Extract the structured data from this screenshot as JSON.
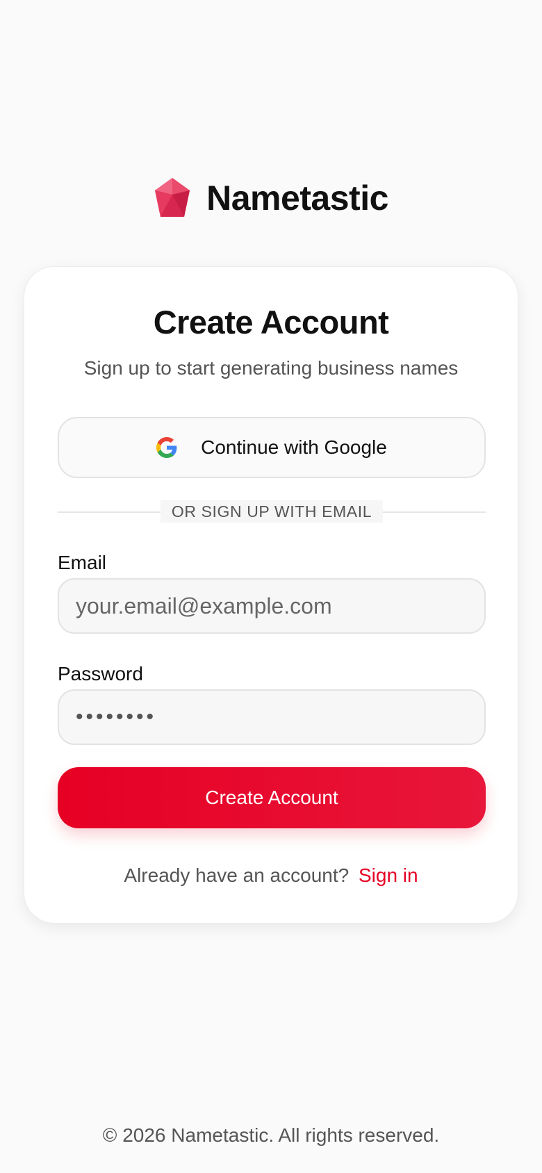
{
  "brand": {
    "name": "Nametastic",
    "accent_color": "#e60024"
  },
  "card": {
    "title": "Create Account",
    "subtitle": "Sign up to start generating business names",
    "google_button_label": "Continue with Google",
    "divider_text": "OR SIGN UP WITH EMAIL",
    "email_label": "Email",
    "email_placeholder": "your.email@example.com",
    "password_label": "Password",
    "password_placeholder": "••••••••",
    "submit_label": "Create Account",
    "signin_prompt": "Already have an account?",
    "signin_link": "Sign in"
  },
  "icons": {
    "brand_logo": "gem-icon",
    "google": "google-icon"
  },
  "footer": {
    "text": "© 2026 Nametastic. All rights reserved."
  }
}
